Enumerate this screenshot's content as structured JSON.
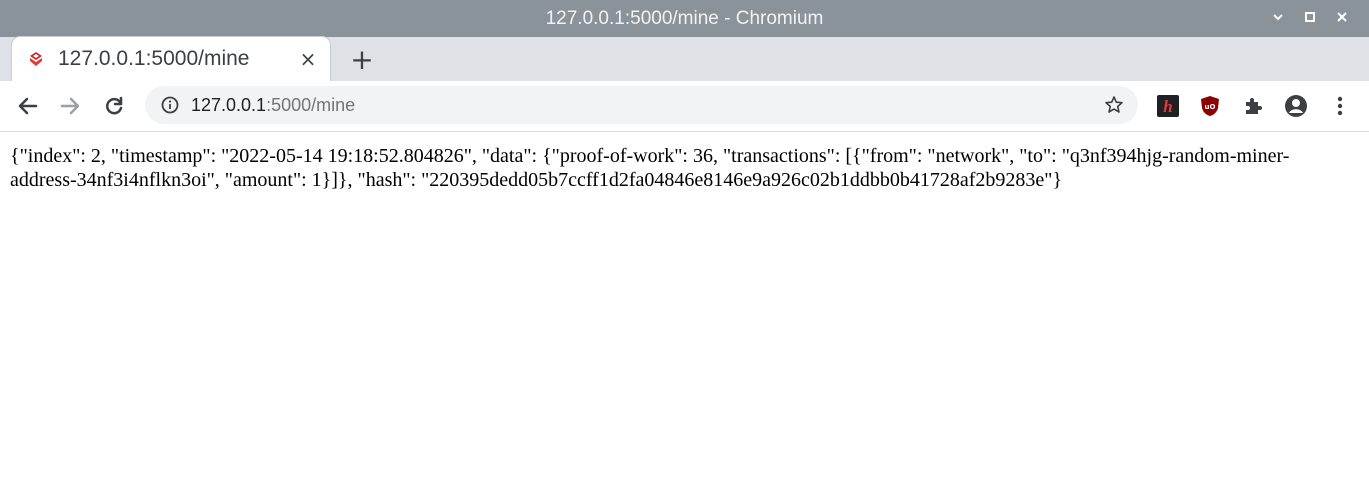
{
  "window": {
    "title": "127.0.0.1:5000/mine - Chromium",
    "controls": [
      "chevron-down",
      "maximize",
      "close"
    ]
  },
  "tab": {
    "title": "127.0.0.1:5000/mine",
    "close_icon": "×"
  },
  "newtab_icon": "+",
  "omnibox": {
    "host": "127.0.0.1",
    "path": ":5000/mine"
  },
  "page": {
    "body_text": "{\"index\": 2, \"timestamp\": \"2022-05-14 19:18:52.804826\", \"data\": {\"proof-of-work\": 36, \"transactions\": [{\"from\": \"network\", \"to\": \"q3nf394hjg-random-miner-address-34nf3i4nflkn3oi\", \"amount\": 1}]}, \"hash\": \"220395dedd05b7ccff1d2fa04846e8146e9a926c02b1ddbb0b41728af2b9283e\"}"
  },
  "colors": {
    "titlebar": "#8a9399",
    "tabstrip": "#dee1e6",
    "omnibox": "#f1f3f4",
    "ext_h": "#d93025",
    "ext_ublock": "#800000"
  }
}
